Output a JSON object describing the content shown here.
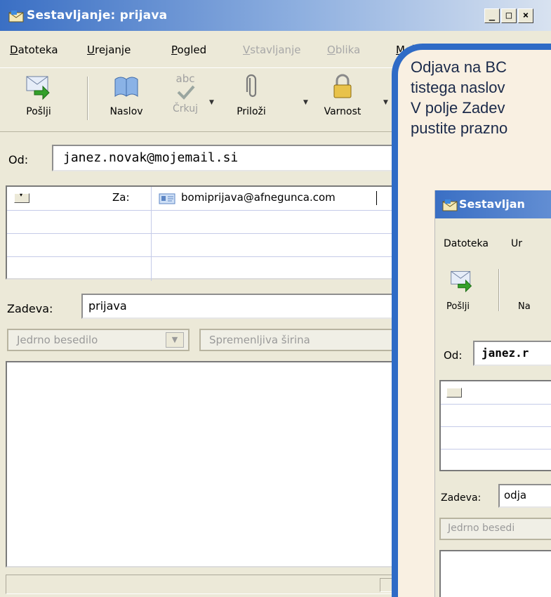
{
  "window": {
    "title": "Sestavljanje: prijava"
  },
  "window_buttons": [
    "_",
    "□",
    "×"
  ],
  "menu": {
    "items": [
      {
        "label": "Datoteka",
        "disabled": false
      },
      {
        "label": "Urejanje",
        "disabled": false
      },
      {
        "label": "Pogled",
        "disabled": false
      },
      {
        "label": "Vstavljanje",
        "disabled": true
      },
      {
        "label": "Oblika",
        "disabled": true
      },
      {
        "label": "Mož",
        "disabled": false
      }
    ]
  },
  "toolbar": {
    "send": "Pošlji",
    "address": "Naslov",
    "spell_top": "abc",
    "spell": "Črkuj",
    "attach": "Priloži",
    "security": "Varnost"
  },
  "from": {
    "label": "Od:",
    "value": "janez.novak@mojemail.si"
  },
  "recipients": {
    "rows": [
      {
        "type": "Za:",
        "address": "bomiprijava@afnegunca.com"
      },
      {
        "type": "",
        "address": ""
      },
      {
        "type": "",
        "address": ""
      },
      {
        "type": "",
        "address": ""
      }
    ]
  },
  "subject": {
    "label": "Zadeva:",
    "value": "prijava"
  },
  "format": {
    "body_format": "Jedrno besedilo",
    "font": "Spremenljiva širina"
  },
  "callout": {
    "lines": [
      "Odjava na BC",
      "tistega naslov",
      "V polje Zadev",
      "pustite prazno"
    ],
    "inset": {
      "title": "Sestavljan",
      "menu_file": "Datoteka",
      "menu_edit": "Ur",
      "send": "Pošlji",
      "address_partial": "Na",
      "from_label": "Od:",
      "from_value": "janez.r",
      "subject_label": "Zadeva:",
      "subject_value": "odja",
      "body_format": "Jedrno besedi"
    }
  }
}
